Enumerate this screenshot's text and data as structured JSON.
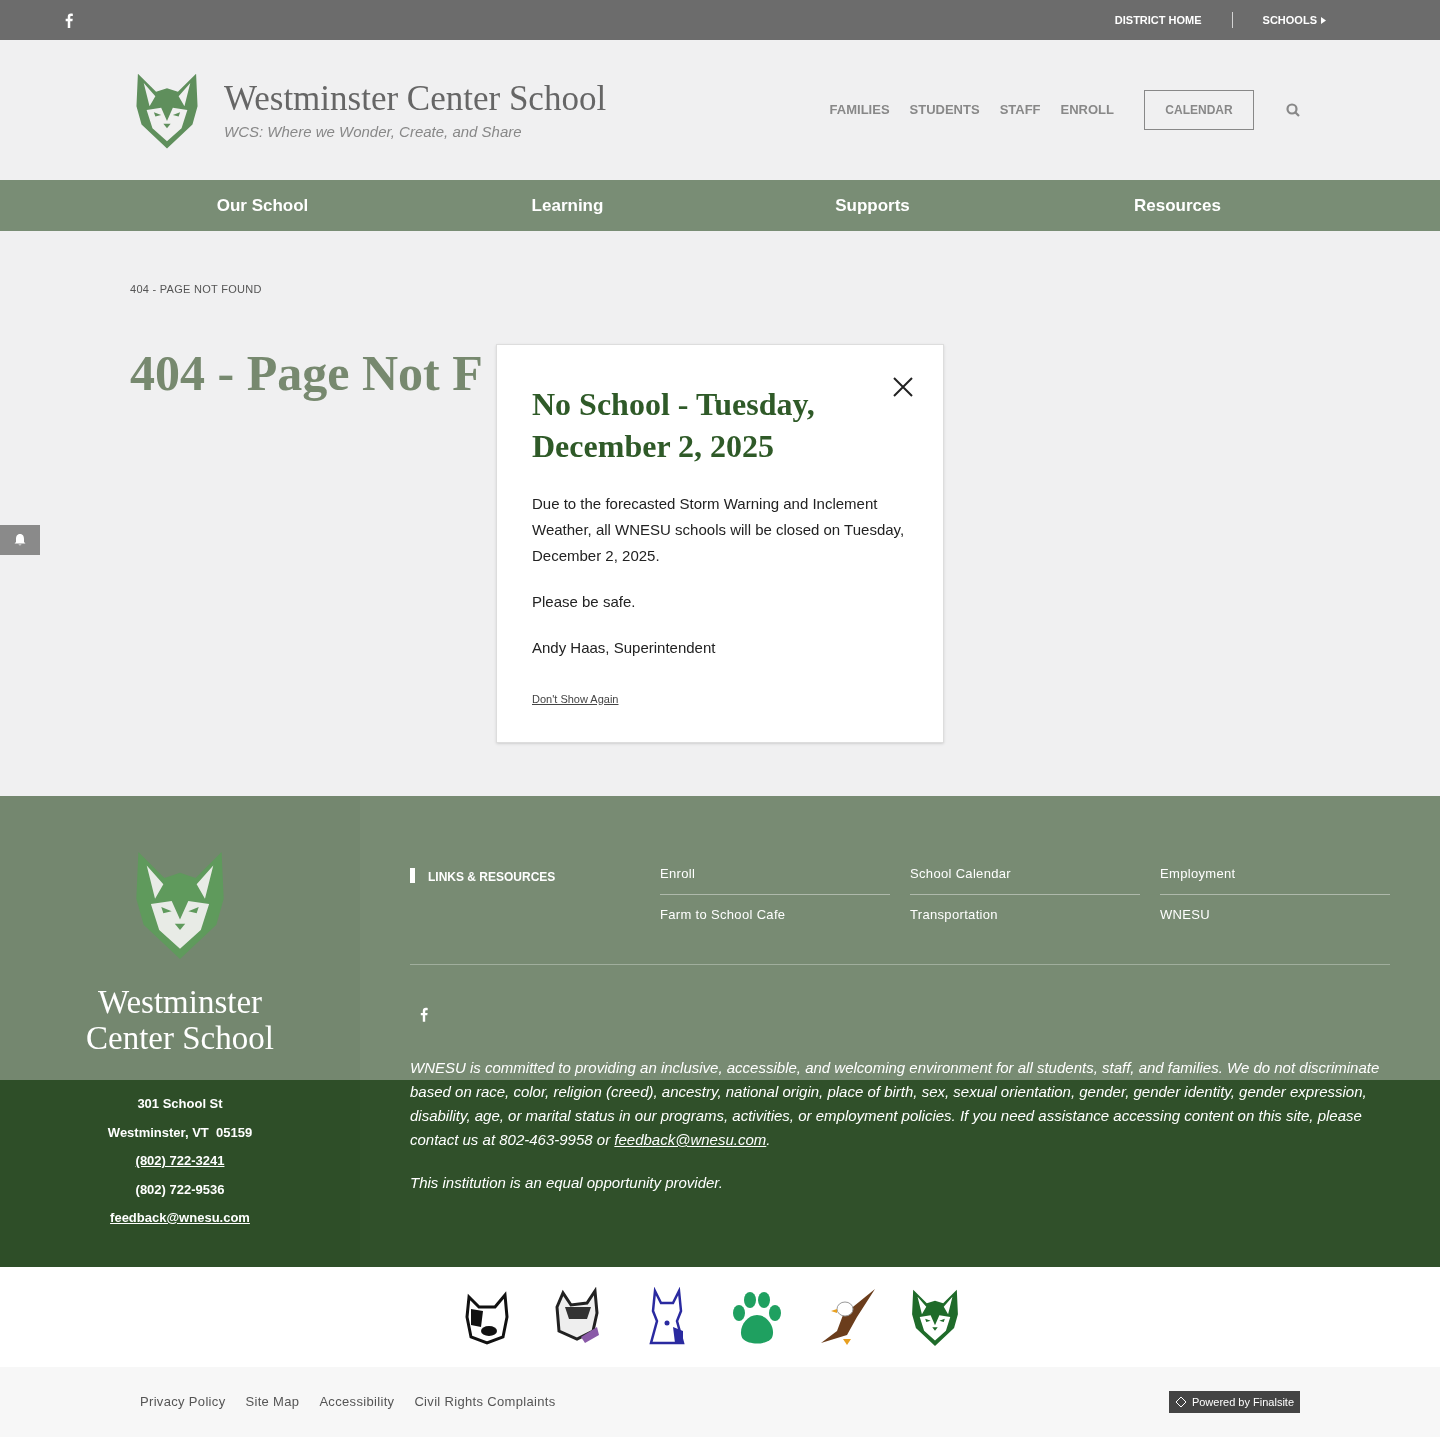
{
  "top_bar": {
    "links": [
      {
        "label": "DISTRICT HOME",
        "kind": "link"
      },
      {
        "label": "SCHOOLS",
        "kind": "dropdown"
      }
    ]
  },
  "header": {
    "title": "Westminster Center School",
    "tagline": "WCS: Where we Wonder, Create, and Share",
    "nav_links": [
      "FAMILIES",
      "STUDENTS",
      "STAFF",
      "ENROLL"
    ],
    "calendar_button": "CALENDAR"
  },
  "main_nav": [
    "Our School",
    "Learning",
    "Supports",
    "Resources"
  ],
  "breadcrumb": "404 - PAGE NOT FOUND",
  "page_title": "404 - Page Not F",
  "alert": {
    "title": "No School - Tuesday, December 2, 2025",
    "paragraphs": [
      "Due to the forecasted Storm Warning and Inclement Weather, all WNESU schools will be closed on Tuesday, December 2, 2025.",
      "Please be safe.",
      "Andy Haas, Superintendent"
    ],
    "dismiss_link": "Don't Show Again"
  },
  "footer": {
    "school_name": "Westminster Center School",
    "contact": [
      {
        "text": "301 School St",
        "link": false
      },
      {
        "text": "Westminster, VT  05159",
        "link": false
      },
      {
        "text": "(802) 722-3241",
        "link": true
      },
      {
        "text": "(802) 722-9536",
        "link": false
      },
      {
        "text": "feedback@wnesu.com",
        "link": true
      }
    ],
    "links_heading": "LINKS & RESOURCES",
    "links": [
      "Enroll",
      "School Calendar",
      "Employment",
      "Farm to School Cafe",
      "Transportation",
      "WNESU"
    ],
    "statement": {
      "before": "WNESU is committed to providing an inclusive, accessible, and welcoming environment for all students, staff, and families. We do not discriminate based on race, color, religion (creed), ancestry, national origin, place of birth, sex, sexual orientation, gender, gender identity, gender expression, disability, age, or marital status in our programs, activities, or employment policies. If you need assistance accessing content on this site, please contact us at 802-463-9958 or ",
      "link": "feedback@wnesu.com",
      "after": "."
    },
    "equal_opportunity": "This institution is an equal opportunity provider."
  },
  "mascots": [
    {
      "kind": "bulldog"
    },
    {
      "kind": "bulldog_collar"
    },
    {
      "kind": "bulldog_sitting"
    },
    {
      "kind": "paw"
    },
    {
      "kind": "eagle"
    },
    {
      "kind": "wolf"
    }
  ],
  "bottom_links": [
    "Privacy Policy",
    "Site Map",
    "Accessibility",
    "Civil Rights Complaints"
  ],
  "powered_by": "Powered by Finalsite"
}
